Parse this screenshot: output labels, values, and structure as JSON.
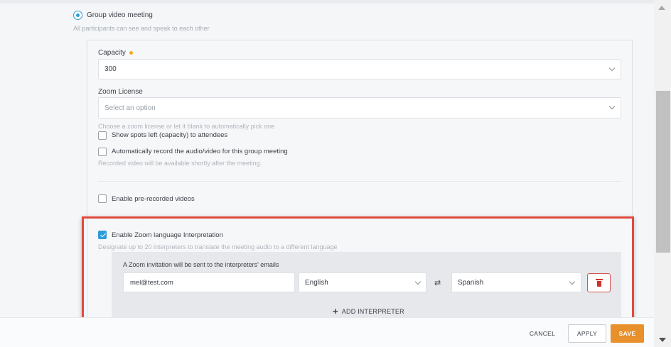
{
  "meeting_type": {
    "option_label": "Group video meeting",
    "option_help": "All participants can see and speak to each other"
  },
  "capacity": {
    "label": "Capacity",
    "value": "300"
  },
  "zoom_license": {
    "label": "Zoom License",
    "placeholder": "Select an option",
    "help": "Choose a zoom license or let it blank to automatically pick one"
  },
  "options": {
    "show_spots_label": "Show spots left (capacity) to attendees",
    "auto_record_label": "Automatically record the audio/video for this group meeting",
    "auto_record_help": "Recorded video will be available shortly after the meeting.",
    "prerecorded_label": "Enable pre-recorded videos"
  },
  "interpretation": {
    "label": "Enable Zoom language Interpretation",
    "help": "Designate up to 20 interpreters to translate the meeting audio to a different language",
    "invitation_note": "A Zoom invitation will be sent to the interpreters' emails",
    "interpreter": {
      "email": "mel@test.com",
      "from_language": "English",
      "to_language": "Spanish",
      "swap_symbol": "⇄"
    },
    "add_label": "ADD INTERPRETER"
  },
  "footer": {
    "cancel_label": "CANCEL",
    "apply_label": "APPLY",
    "save_label": "SAVE"
  },
  "colors": {
    "accent": "#2d9cdb",
    "save": "#e8902b",
    "highlight": "#e04a3f",
    "required_dot": "#f5a623"
  }
}
